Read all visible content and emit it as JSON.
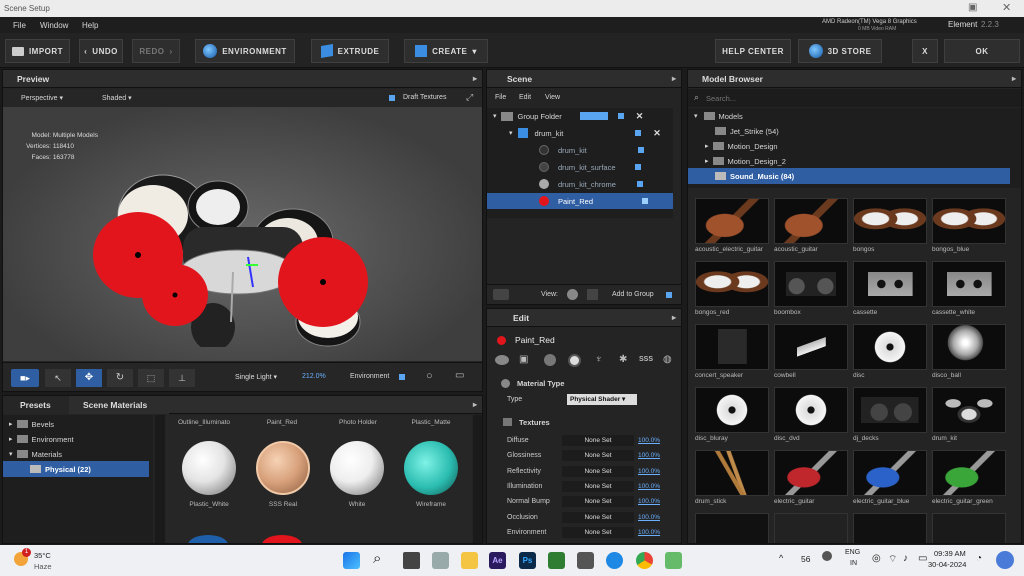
{
  "window": {
    "title": "Scene Setup",
    "gpu_name": "AMD Radeon(TM) Vega 8 Graphics",
    "gpu_ram": "0 MB Video RAM",
    "app_name": "Element",
    "version": "2.2.3"
  },
  "menu": [
    "File",
    "Window",
    "Help"
  ],
  "toolbar": {
    "import": "IMPORT",
    "undo": "UNDO",
    "redo": "REDO",
    "environment": "ENVIRONMENT",
    "extrude": "EXTRUDE",
    "create": "CREATE",
    "help_center": "HELP CENTER",
    "store": "3D STORE",
    "close": "X",
    "ok": "OK"
  },
  "preview": {
    "title": "Preview",
    "view_mode": "Perspective",
    "shading": "Shaded",
    "draft_textures": "Draft Textures",
    "stats": {
      "model_label": "Model:",
      "model_value": "Multiple Models",
      "vertices_label": "Vertices:",
      "vertices_value": "118410",
      "faces_label": "Faces:",
      "faces_value": "163778"
    },
    "light_mode": "Single Light",
    "light_percent": "212.0%",
    "environment_label": "Environment"
  },
  "scene": {
    "title": "Scene",
    "menu": [
      "File",
      "Edit",
      "View"
    ],
    "items": [
      {
        "label": "Group Folder",
        "level": 0,
        "selected": false
      },
      {
        "label": "drum_kit",
        "level": 1,
        "selected": false
      },
      {
        "label": "drum_kit",
        "level": 2,
        "selected": false
      },
      {
        "label": "drum_kit_surface",
        "level": 2,
        "selected": false
      },
      {
        "label": "drum_kit_chrome",
        "level": 2,
        "selected": false
      },
      {
        "label": "Paint_Red",
        "level": 2,
        "selected": true
      }
    ],
    "view_label": "View:",
    "add_to_group": "Add to Group"
  },
  "model_browser": {
    "title": "Model Browser",
    "search_placeholder": "Search...",
    "tree": [
      {
        "label": "Models",
        "level": 0,
        "selected": false
      },
      {
        "label": "Jet_Strike (54)",
        "level": 1,
        "selected": false
      },
      {
        "label": "Motion_Design",
        "level": 1,
        "selected": false
      },
      {
        "label": "Motion_Design_2",
        "level": 1,
        "selected": false
      },
      {
        "label": "Sound_Music (84)",
        "level": 1,
        "selected": true
      }
    ],
    "models": [
      {
        "label": "acoustic_electric_guitar",
        "icon": "guitar"
      },
      {
        "label": "acoustic_guitar",
        "icon": "guitar"
      },
      {
        "label": "bongos",
        "icon": "bongos"
      },
      {
        "label": "bongos_blue",
        "icon": "bongos"
      },
      {
        "label": "bongos_red",
        "icon": "bongos"
      },
      {
        "label": "boombox",
        "icon": "boombox"
      },
      {
        "label": "cassette",
        "icon": "cassette"
      },
      {
        "label": "cassette_white",
        "icon": "cassette"
      },
      {
        "label": "concert_speaker",
        "icon": "speaker"
      },
      {
        "label": "cowbell",
        "icon": "cowbell"
      },
      {
        "label": "disc",
        "icon": "disc"
      },
      {
        "label": "disco_ball",
        "icon": "disco-ball"
      },
      {
        "label": "disc_bluray",
        "icon": "disc"
      },
      {
        "label": "disc_dvd",
        "icon": "disc"
      },
      {
        "label": "dj_decks",
        "icon": "decks"
      },
      {
        "label": "drum_kit",
        "icon": "drums"
      },
      {
        "label": "drum_stick",
        "icon": "sticks"
      },
      {
        "label": "electric_guitar",
        "icon": "guitar"
      },
      {
        "label": "electric_guitar_blue",
        "icon": "guitar"
      },
      {
        "label": "electric_guitar_green",
        "icon": "guitar"
      }
    ]
  },
  "presets": {
    "tabs": [
      "Presets",
      "Scene Materials"
    ],
    "tree": [
      {
        "label": "Bevels",
        "level": 0,
        "selected": false
      },
      {
        "label": "Environment",
        "level": 0,
        "selected": false
      },
      {
        "label": "Materials",
        "level": 0,
        "selected": false
      },
      {
        "label": "Physical (22)",
        "level": 1,
        "selected": true
      }
    ],
    "top_labels": [
      "Outline_Illuminato",
      "Paint_Red",
      "Photo Holder",
      "Plastic_Matte"
    ],
    "materials": [
      {
        "label": "Plastic_White",
        "color": "#e4e4e4"
      },
      {
        "label": "SSS Real",
        "color": "#d7a07a"
      },
      {
        "label": "White",
        "color": "#eeeeee"
      },
      {
        "label": "Wireframe",
        "color": "#2bbcb0"
      }
    ]
  },
  "edit": {
    "title": "Edit",
    "material_name": "Paint_Red",
    "material_type_label": "Material Type",
    "type_label": "Type",
    "type_value": "Physical Shader",
    "textures_label": "Textures",
    "props": [
      {
        "name": "Diffuse",
        "value": "None Set",
        "percent": "100.0%"
      },
      {
        "name": "Glossiness",
        "value": "None Set",
        "percent": "100.0%"
      },
      {
        "name": "Reflectivity",
        "value": "None Set",
        "percent": "100.0%"
      },
      {
        "name": "Illumination",
        "value": "None Set",
        "percent": "100.0%"
      },
      {
        "name": "Normal Bump",
        "value": "None Set",
        "percent": "100.0%"
      },
      {
        "name": "Occlusion",
        "value": "None Set",
        "percent": "100.0%"
      },
      {
        "name": "Environment",
        "value": "None Set",
        "percent": "100.0%"
      }
    ]
  },
  "taskbar": {
    "temperature": "35°C",
    "weather": "Haze",
    "notification_count": "1",
    "counter": "56",
    "lang": "ENG",
    "region": "IN",
    "time": "09:39 AM",
    "date": "30-04-2024"
  },
  "colors": {
    "accent": "#2f5ea3",
    "link": "#6ab0ff",
    "cymbal_red": "#e3151c"
  }
}
